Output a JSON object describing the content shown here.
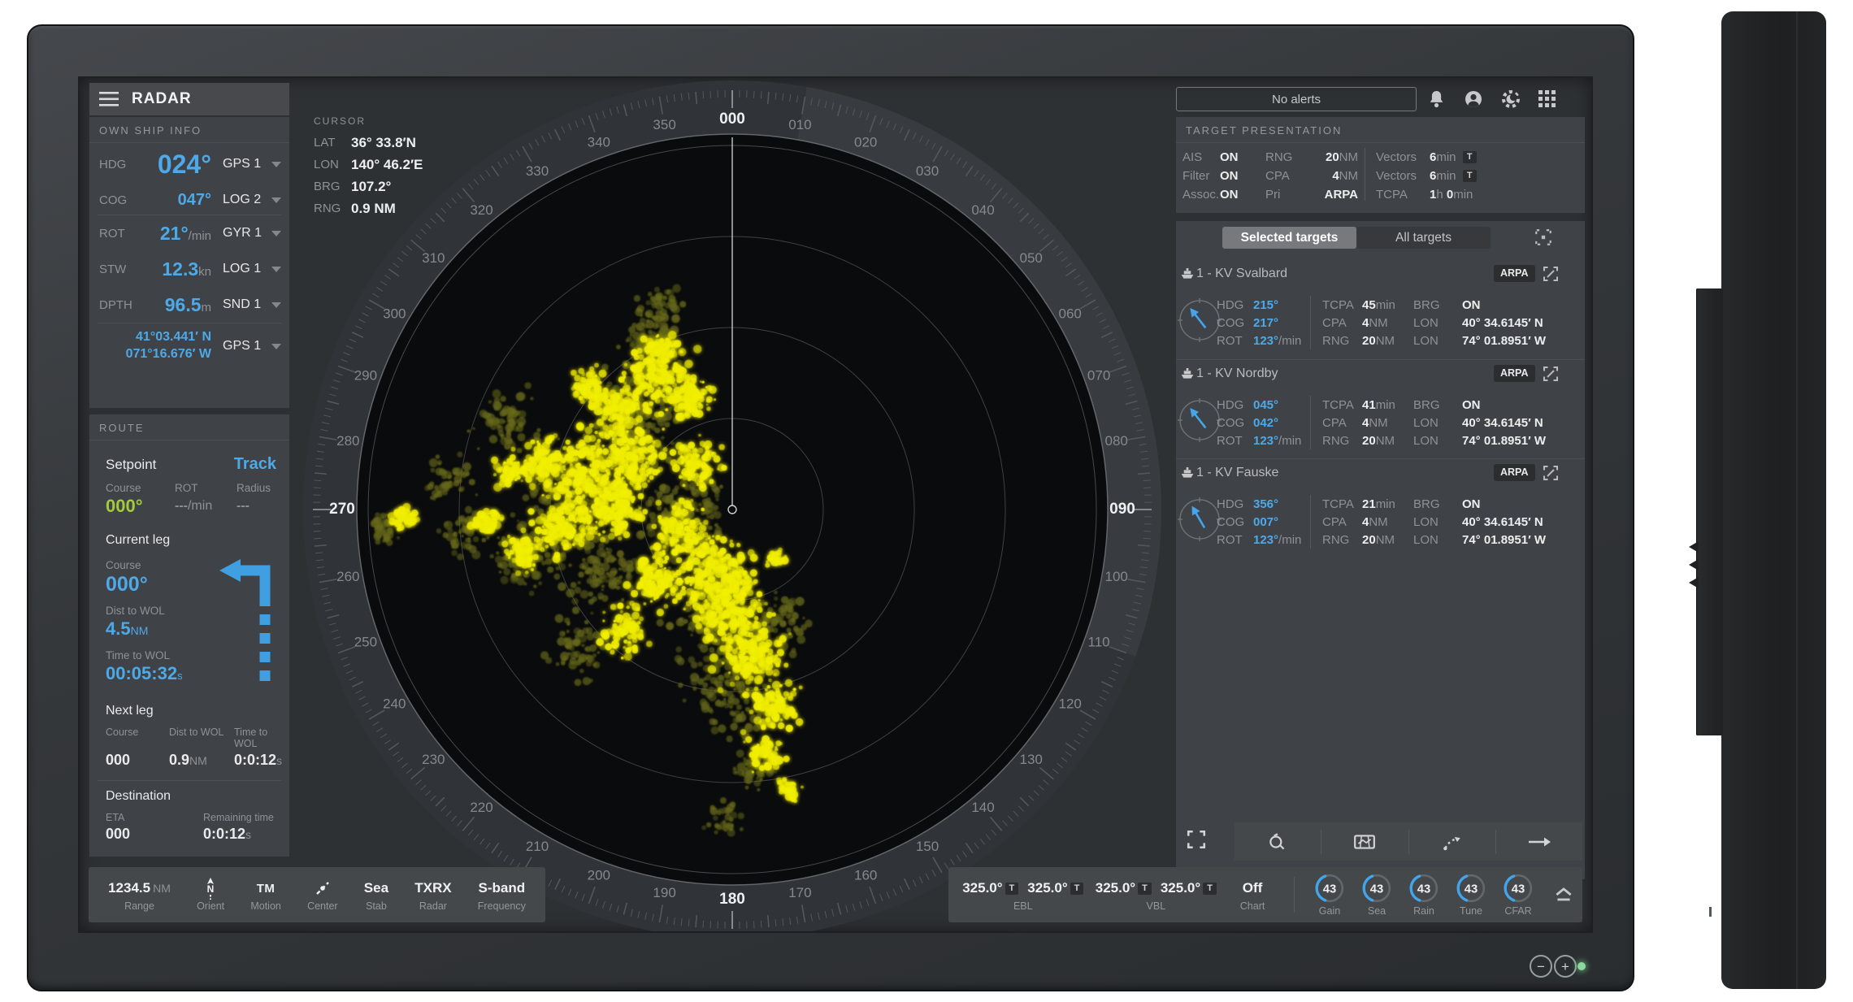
{
  "app": {
    "title": "RADAR"
  },
  "own_ship": {
    "title": "OWN SHIP INFO",
    "hdg_label": "HDG",
    "hdg_value": "024°",
    "hdg_source": "GPS 1",
    "cog_label": "COG",
    "cog_value": "047°",
    "cog_source": "LOG 2",
    "rot_label": "ROT",
    "rot_value": "21°",
    "rot_unit": "/min",
    "rot_source": "GYR 1",
    "stw_label": "STW",
    "stw_value": "12.3",
    "stw_unit": "kn",
    "stw_source": "LOG 1",
    "dpth_label": "DPTH",
    "dpth_value": "96.5",
    "dpth_unit": "m",
    "dpth_source": "SND 1",
    "pos_lat": "41°03.441′ N",
    "pos_lon": "071°16.676′ W",
    "pos_source": "GPS 1"
  },
  "route": {
    "title": "ROUTE",
    "setpoint_label": "Setpoint",
    "setpoint_value": "Track",
    "course_label": "Course",
    "course_value": "000°",
    "rot_label": "ROT",
    "rot_value": "---",
    "rot_unit": "/min",
    "radius_label": "Radius",
    "radius_value": "---",
    "current_leg_title": "Current leg",
    "cl_course_label": "Course",
    "cl_course_value": "000°",
    "cl_dist_label": "Dist to WOL",
    "cl_dist_value": "4.5",
    "cl_dist_unit": "NM",
    "cl_time_label": "Time to WOL",
    "cl_time_value": "00:05:32",
    "cl_time_unit": "s",
    "next_leg_title": "Next leg",
    "nl_course_label": "Course",
    "nl_course_value": "000",
    "nl_dist_label": "Dist to WOL",
    "nl_dist_value": "0.9",
    "nl_dist_unit": "NM",
    "nl_time_label": "Time to WOL",
    "nl_time_value": "0:0:12",
    "nl_time_unit": "s",
    "destination_title": "Destination",
    "eta_label": "ETA",
    "eta_value": "000",
    "remaining_label": "Remaining time",
    "remaining_value": "0:0:12",
    "remaining_unit": "s"
  },
  "cursor": {
    "title": "CURSOR",
    "lat_label": "LAT",
    "lat": "36° 33.8′N",
    "lon_label": "LON",
    "lon": "140° 46.2′E",
    "brg_label": "BRG",
    "brg": "107.2°",
    "rng_label": "RNG",
    "rng": "0.9 NM"
  },
  "alerts": {
    "text": "No alerts"
  },
  "target_presentation": {
    "title": "TARGET PRESENTATION",
    "rows": [
      {
        "l1": "AIS",
        "v1": "ON",
        "l2": "RNG",
        "v2": "20",
        "u2": "NM",
        "l3": "Vectors",
        "v3": "6",
        "u3": "min",
        "chip": "T"
      },
      {
        "l1": "Filter",
        "v1": "ON",
        "l2": "CPA",
        "v2": "4",
        "u2": "NM",
        "l3": "Vectors",
        "v3": "6",
        "u3": "min",
        "chip": "T"
      },
      {
        "l1": "Assoc.",
        "v1": "ON",
        "l2": "Pri",
        "v2": "ARPA",
        "u2": "",
        "l3": "TCPA",
        "v3": "1",
        "u3": "h",
        "v4": "0",
        "u4": "min"
      }
    ]
  },
  "tabs": {
    "selected": "Selected targets",
    "all": "All targets"
  },
  "card_labels": {
    "hdg": "HDG",
    "cog": "COG",
    "rot": "ROT",
    "rot_unit": "/min",
    "tcpa": "TCPA",
    "tcpa_unit": "min",
    "cpa": "CPA",
    "cpa_unit": "NM",
    "rng": "RNG",
    "rng_unit": "NM",
    "brg": "BRG",
    "lat": "LON",
    "lon": "LON"
  },
  "targets": [
    {
      "name": "1 - KV Svalbard",
      "badge": "ARPA",
      "hdg": "215°",
      "cog": "217°",
      "rot": "123°",
      "tcpa": "45",
      "cpa": "4",
      "rng": "20",
      "brg": "ON",
      "lat": "40° 34.6145′ N",
      "lon": "74° 01.8951′ W"
    },
    {
      "name": "1 - KV Nordby",
      "badge": "ARPA",
      "hdg": "045°",
      "cog": "042°",
      "rot": "123°",
      "tcpa": "41",
      "cpa": "4",
      "rng": "20",
      "brg": "ON",
      "lat": "40° 34.6145′ N",
      "lon": "74° 01.8951′ W"
    },
    {
      "name": "1 - KV Fauske",
      "badge": "ARPA",
      "hdg": "356°",
      "cog": "007°",
      "rot": "123°",
      "tcpa": "21",
      "cpa": "4",
      "rng": "20",
      "brg": "ON",
      "lat": "40° 34.6145′ N",
      "lon": "74° 01.8951′ W"
    }
  ],
  "bottom_left": {
    "range_value": "1234.5",
    "range_unit": "NM",
    "range_label": "Range",
    "orient_value": "N",
    "orient_label": "Orient",
    "motion_value": "TM",
    "motion_label": "Motion",
    "center_label": "Center",
    "stab_value": "Sea",
    "stab_label": "Stab",
    "radar_value": "TXRX",
    "radar_label": "Radar",
    "freq_value": "S-band",
    "freq_label": "Frequency"
  },
  "bottom_right": {
    "ebl_v1": "325.0°",
    "ebl_v2": "325.0°",
    "ebl_chip": "T",
    "ebl_label": "EBL",
    "vbl_v1": "325.0°",
    "vbl_v2": "325.0°",
    "vbl_chip": "T",
    "vbl_label": "VBL",
    "chart_value": "Off",
    "chart_label": "Chart",
    "gauges": [
      {
        "value": "43",
        "label": "Gain"
      },
      {
        "value": "43",
        "label": "Sea"
      },
      {
        "value": "43",
        "label": "Rain"
      },
      {
        "value": "43",
        "label": "Tune"
      },
      {
        "value": "43",
        "label": "CFAR"
      }
    ]
  },
  "radar": {
    "ring_labels": [
      "000",
      "010",
      "020",
      "030",
      "040",
      "050",
      "060",
      "070",
      "080",
      "090",
      "100",
      "110",
      "120",
      "130",
      "140",
      "150",
      "160",
      "170",
      "180",
      "190",
      "200",
      "210",
      "220",
      "230",
      "240",
      "250",
      "260",
      "270",
      "280",
      "290",
      "300",
      "310",
      "320",
      "330",
      "340",
      "350"
    ],
    "colors": {
      "echo_bright": "#f2ef00",
      "echo_dim": "#686a1d"
    },
    "clusters": {
      "bright": [
        [
          -86,
          -198,
          18,
          50
        ],
        [
          -94,
          -164,
          45,
          170
        ],
        [
          -50,
          -140,
          30,
          90
        ],
        [
          -140,
          -120,
          35,
          110
        ],
        [
          -124,
          -60,
          45,
          170
        ],
        [
          -183,
          -45,
          55,
          200
        ],
        [
          -236,
          -57,
          30,
          90
        ],
        [
          -273,
          -45,
          22,
          60
        ],
        [
          -303,
          15,
          20,
          50
        ],
        [
          -404,
          10,
          16,
          40
        ],
        [
          -258,
          52,
          25,
          70
        ],
        [
          -210,
          20,
          35,
          110
        ],
        [
          -150,
          0,
          40,
          150
        ],
        [
          -94,
          89,
          35,
          120
        ],
        [
          -131,
          149,
          30,
          85
        ],
        [
          -64,
          30,
          40,
          150
        ],
        [
          -19,
          75,
          45,
          170
        ],
        [
          -4,
          119,
          50,
          180
        ],
        [
          25,
          179,
          45,
          160
        ],
        [
          55,
          239,
          35,
          100
        ],
        [
          40,
          298,
          25,
          60
        ],
        [
          70,
          343,
          15,
          30
        ],
        [
          55,
          60,
          12,
          25
        ],
        [
          -45,
          -55,
          30,
          100
        ],
        [
          -175,
          -150,
          25,
          70
        ]
      ],
      "dim": [
        [
          -120,
          -120,
          60,
          150
        ],
        [
          -200,
          -20,
          70,
          180
        ],
        [
          -60,
          0,
          60,
          150
        ],
        [
          -20,
          140,
          60,
          140
        ],
        [
          -100,
          -200,
          40,
          90
        ],
        [
          0,
          230,
          55,
          110
        ],
        [
          -250,
          60,
          45,
          90
        ],
        [
          -330,
          30,
          30,
          55
        ],
        [
          -160,
          80,
          50,
          110
        ],
        [
          -90,
          -250,
          30,
          55
        ],
        [
          -430,
          20,
          24,
          40
        ],
        [
          30,
          320,
          30,
          50
        ],
        [
          -10,
          380,
          22,
          35
        ],
        [
          -280,
          -110,
          40,
          75
        ],
        [
          -350,
          -40,
          30,
          50
        ],
        [
          60,
          140,
          35,
          60
        ],
        [
          -190,
          170,
          40,
          70
        ]
      ]
    }
  },
  "bezel": {
    "minus": "−",
    "plus": "+"
  }
}
